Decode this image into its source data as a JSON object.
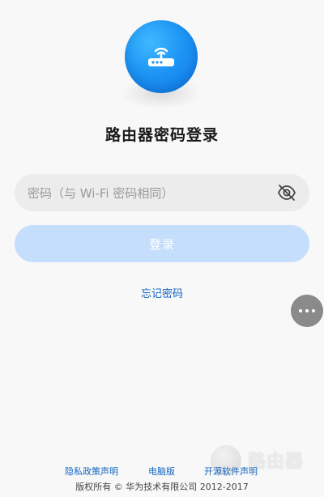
{
  "header": {
    "title": "路由器密码登录"
  },
  "logo": {
    "icon": "router-icon",
    "color": "#1e96f5"
  },
  "password": {
    "placeholder": "密码（与 Wi-Fi 密码相同）",
    "value": "",
    "toggle_icon": "eye-off-icon"
  },
  "login_button": {
    "label": "登录",
    "color": "#c4defc"
  },
  "forgot_link": {
    "label": "忘记密码"
  },
  "floating_menu": {
    "icon": "more-icon"
  },
  "footer": {
    "links": [
      "隐私政策声明",
      "电脑版",
      "开源软件声明"
    ],
    "copyright": "版权所有 © 华为技术有限公司 2012-2017"
  },
  "watermark": {
    "text": "路由器"
  }
}
